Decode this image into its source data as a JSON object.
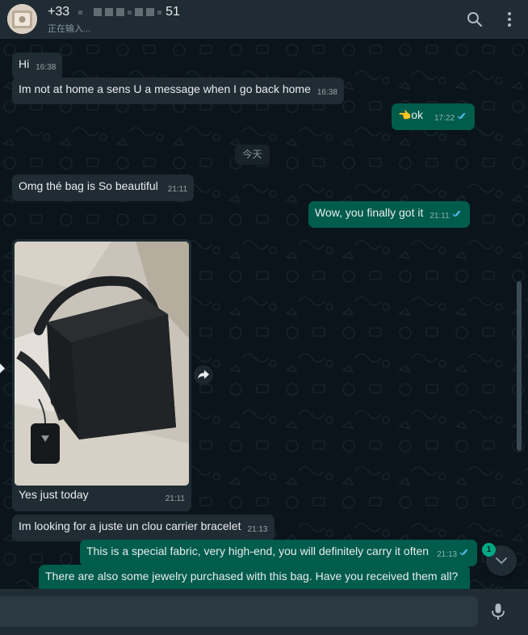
{
  "header": {
    "contact_prefix": "+33",
    "contact_suffix": "51",
    "status": "正在输入...",
    "search_icon": "search-icon",
    "menu_icon": "kebab-menu-icon"
  },
  "messages": [
    {
      "dir": "in",
      "text": "Hi",
      "time": "16:38"
    },
    {
      "dir": "in",
      "text": "Im not at home a sens U a message when I go back home",
      "time": "16:38"
    },
    {
      "dir": "out",
      "emoji": "👈",
      "text": "ok",
      "time": "17:22"
    },
    {
      "dir": "in",
      "text": "Omg thé bag is So beautiful",
      "time": "21:11"
    },
    {
      "dir": "out",
      "text": "Wow, you finally got it",
      "time": "21:11"
    },
    {
      "dir": "in",
      "type": "image",
      "caption": "Yes just today",
      "time": "21:11"
    },
    {
      "dir": "in",
      "text": "Im looking for a juste un clou carrier bracelet",
      "time": "21:13"
    },
    {
      "dir": "out",
      "text": "This is a special fabric, very high-end, you will definitely carry it often",
      "time": "21:13"
    },
    {
      "dir": "out",
      "text": "There are also some jewelry purchased with this bag. Have you received them all?",
      "time": ""
    }
  ],
  "date_divider": "今天",
  "unread_count": "1",
  "composer": {
    "placeholder": "",
    "mic_icon": "mic-icon"
  },
  "colors": {
    "header_bg": "#202c33",
    "chat_bg": "#0b141a",
    "incoming_bubble": "#202c33",
    "outgoing_bubble": "#005c4b",
    "accent": "#00a884",
    "read_ticks": "#53bdeb"
  }
}
